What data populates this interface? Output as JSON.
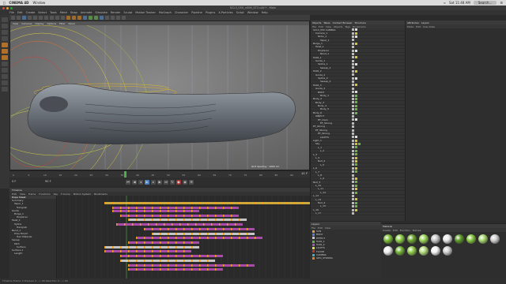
{
  "mac_menu": {
    "app_name": "CINEMA 4D",
    "window_menu": "Window",
    "clock": "Sat 11:48 AM",
    "search_placeholder": "Search..."
  },
  "app": {
    "title": "SCL3_050_v006_ST3.c4d * - Main"
  },
  "main_menu": [
    "File",
    "Edit",
    "Create",
    "Select",
    "Tools",
    "Mesh",
    "Snap",
    "Animate",
    "Simulate",
    "Render",
    "Sculpt",
    "Motion Tracker",
    "MoGraph",
    "Character",
    "Pipeline",
    "Plugins",
    "X-Particles",
    "Script",
    "Window",
    "Help"
  ],
  "viewport": {
    "menu": [
      "View",
      "Cameras",
      "Display",
      "Options",
      "Filter",
      "Panel"
    ],
    "label": "Perspective",
    "grid_spacing": "Grid Spacing : 1000 cm"
  },
  "timeline_ruler": {
    "ticks": [
      "0",
      "5",
      "10",
      "15",
      "20",
      "25",
      "30",
      "35",
      "40",
      "45",
      "50",
      "55",
      "60",
      "65",
      "70",
      "75",
      "80",
      "85",
      "90"
    ],
    "current_frame": "41 F"
  },
  "transport": {
    "start": "0 F",
    "end": "90 F"
  },
  "timeline": {
    "tabs": [
      "Timeline"
    ],
    "menu": [
      "Edit",
      "View",
      "Frame",
      "Functions",
      "Key",
      "F-Curve",
      "Motion System",
      "Bookmarks"
    ],
    "header": "Dope Sheet",
    "tracks": [
      "Summary",
      "Taper_1",
      "Hairgrab",
      "Guide",
      "Bulge_1",
      "Displacer",
      "Twist_1",
      "Spline",
      "Hairgrab",
      "Bend_1",
      "Pose Morph",
      "Hair Material",
      "Sweep",
      "Path",
      "Surface",
      "Surface 1",
      "Length"
    ]
  },
  "status": {
    "text": "Timeline Frame: 0  Preview: 0 --> 90     Selection: 0 --> 90"
  },
  "objects": {
    "tabs": [
      "Objects",
      "Takes",
      "Content Browser",
      "Structure"
    ],
    "menu": [
      "File",
      "Edit",
      "View",
      "Objects",
      "Tags",
      "Bookmarks"
    ],
    "rows": [
      {
        "name": "SCL3_050 CAMERA",
        "tags": [
          "c",
          "k"
        ]
      },
      {
        "name": "Camera_1",
        "tags": [
          "c",
          "y"
        ]
      },
      {
        "name": "NULL_1",
        "tags": [
          "c",
          "k"
        ]
      },
      {
        "name": "Taper_1",
        "tags": [
          "c"
        ]
      },
      {
        "name": "Bulge_1",
        "tags": [
          "c",
          "y"
        ]
      },
      {
        "name": "Twist_1",
        "tags": [
          "c"
        ]
      },
      {
        "name": "Displacer",
        "tags": [
          "c",
          "k"
        ]
      },
      {
        "name": "Bend_1",
        "tags": [
          "c"
        ]
      },
      {
        "name": "HAIR_1",
        "tags": [
          "c",
          "y"
        ]
      },
      {
        "name": "Guide_1",
        "tags": [
          "c"
        ]
      },
      {
        "name": "Spline_1",
        "tags": [
          "c",
          "k"
        ]
      },
      {
        "name": "Sweep_1",
        "tags": [
          "c"
        ]
      },
      {
        "name": "HAIR_2",
        "tags": [
          "c",
          "y"
        ]
      },
      {
        "name": "Guide_2",
        "tags": [
          "c"
        ]
      },
      {
        "name": "Spline_2",
        "tags": [
          "c",
          "k"
        ]
      },
      {
        "name": "Sweep_2",
        "tags": [
          "c"
        ]
      },
      {
        "name": "HAIR_3",
        "tags": [
          "c",
          "y"
        ]
      },
      {
        "name": "Guide_3",
        "tags": [
          "c"
        ]
      },
      {
        "name": "BODY",
        "tags": [
          "c",
          "k"
        ]
      },
      {
        "name": "Body_1",
        "tags": [
          "c",
          "g"
        ]
      },
      {
        "name": "Body_2",
        "tags": [
          "c",
          "g"
        ]
      },
      {
        "name": "Body_3",
        "tags": [
          "c",
          "g"
        ]
      },
      {
        "name": "Body_4",
        "tags": [
          "c",
          "g"
        ]
      },
      {
        "name": "Body_5",
        "tags": [
          "c",
          "g"
        ]
      },
      {
        "name": "Body_6",
        "tags": [
          "c",
          "g"
        ]
      },
      {
        "name": "OBJECT",
        "tags": [
          "c"
        ]
      },
      {
        "name": "EF_main",
        "tags": [
          "c",
          "k"
        ]
      },
      {
        "name": "EF_Strong",
        "tags": [
          "c"
        ]
      },
      {
        "name": "EF_Strong",
        "tags": [
          "c"
        ]
      },
      {
        "name": "EF_Strong",
        "tags": [
          "c"
        ]
      },
      {
        "name": "EF_Strong",
        "tags": [
          "c"
        ]
      },
      {
        "name": "LIGHTS",
        "tags": [
          "c",
          "k"
        ]
      },
      {
        "name": "Light_1",
        "tags": [
          "c",
          "y"
        ]
      },
      {
        "name": "Sky",
        "tags": [
          "c",
          "y",
          "g"
        ]
      },
      {
        "name": "L_1",
        "tags": [
          "c",
          "g"
        ]
      },
      {
        "name": "L_2",
        "tags": [
          "c",
          "g"
        ]
      },
      {
        "name": "L_3",
        "tags": [
          "c",
          "g"
        ]
      },
      {
        "name": "L_4",
        "tags": [
          "c",
          "y"
        ]
      },
      {
        "name": "Null_2",
        "tags": [
          "c",
          "y"
        ]
      },
      {
        "name": "L_5",
        "tags": [
          "c",
          "g"
        ]
      },
      {
        "name": "L_6",
        "tags": [
          "c",
          "y"
        ]
      },
      {
        "name": "L_7",
        "tags": [
          "c",
          "g"
        ]
      },
      {
        "name": "L_8",
        "tags": [
          "c"
        ]
      },
      {
        "name": "L_9",
        "tags": [
          "c",
          "y"
        ]
      },
      {
        "name": "Null_3",
        "tags": [
          "c",
          "g"
        ]
      },
      {
        "name": "L_10",
        "tags": [
          "c",
          "g"
        ]
      },
      {
        "name": "L_11",
        "tags": [
          "c",
          "y"
        ]
      },
      {
        "name": "L_12",
        "tags": [
          "c",
          "g"
        ]
      },
      {
        "name": "L_13",
        "tags": [
          "c"
        ]
      },
      {
        "name": "L_14",
        "tags": [
          "c",
          "y"
        ]
      },
      {
        "name": "Null_4",
        "tags": [
          "c",
          "g"
        ]
      },
      {
        "name": "L_15",
        "tags": [
          "c",
          "g"
        ]
      },
      {
        "name": "L_16",
        "tags": [
          "c",
          "y"
        ]
      },
      {
        "name": "L_17",
        "tags": [
          "c"
        ]
      }
    ]
  },
  "attributes": {
    "tabs": [
      "Attributes",
      "Layers"
    ],
    "menu": [
      "Mode",
      "Edit",
      "User Data"
    ]
  },
  "layers": {
    "tabs": [
      "Layers"
    ],
    "menu": [
      "File",
      "Edit",
      "View"
    ],
    "rows": [
      {
        "name": "SCN",
        "color": "#d7a24a"
      },
      {
        "name": "BODY",
        "color": "#5b7fd6"
      },
      {
        "name": "EFFECT",
        "color": "#c9c9c9"
      },
      {
        "name": "HAIR_1",
        "color": "#6ab04c"
      },
      {
        "name": "HAIR_2",
        "color": "#9b59b6"
      },
      {
        "name": "LIGHTS",
        "color": "#e0e040"
      },
      {
        "name": "FLOOR",
        "color": "#c0392b"
      },
      {
        "name": "CAMERA",
        "color": "#3ab0c0"
      },
      {
        "name": "GEO_STRONG",
        "color": "#e67e22"
      }
    ]
  },
  "materials": {
    "tabs": [
      "Material"
    ],
    "menu": [
      "Create",
      "Edit",
      "Function",
      "Texture"
    ],
    "swatches": [
      "#7fbf3a",
      "#8fcf4a",
      "#6fa932",
      "#9dd65a",
      "#c8c8c8",
      "#e8e8e8",
      "#5f9a2a",
      "#88c840",
      "#a8d870",
      "#d0d0d0",
      "#eeeeee",
      "#73b338",
      "#92cc4c",
      "#b5dd80",
      "#f2f2f2",
      "#cfcfcf"
    ]
  }
}
